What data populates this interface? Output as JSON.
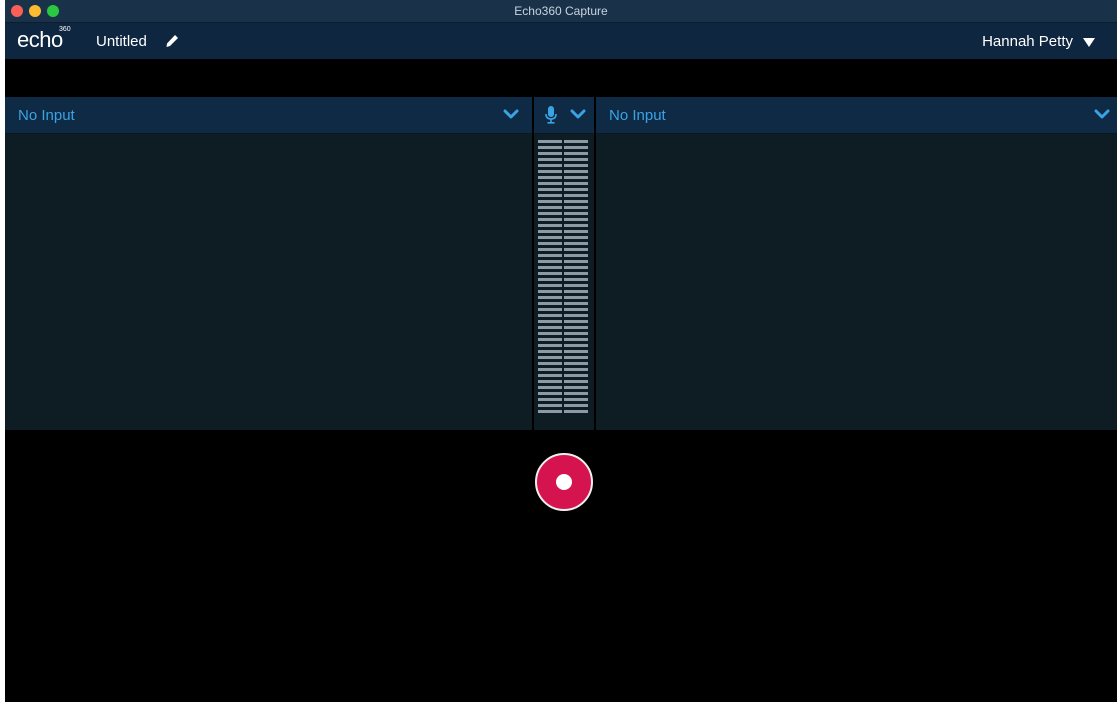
{
  "window": {
    "title": "Echo360 Capture"
  },
  "header": {
    "logo_text": "echo",
    "logo_superscript": "360",
    "recording_title": "Untitled",
    "user_name": "Hannah Petty"
  },
  "sources": {
    "left": {
      "label": "No Input"
    },
    "right": {
      "label": "No Input"
    }
  },
  "audio_meter": {
    "segments_per_channel": 46
  },
  "colors": {
    "accent": "#3aa3e3",
    "record": "#d5144f",
    "header_bg": "#0e2640",
    "panel_bg": "#0e1c24"
  },
  "icons": [
    "pencil-icon",
    "chevron-down-icon",
    "microphone-icon",
    "caret-down-icon",
    "record-icon"
  ]
}
